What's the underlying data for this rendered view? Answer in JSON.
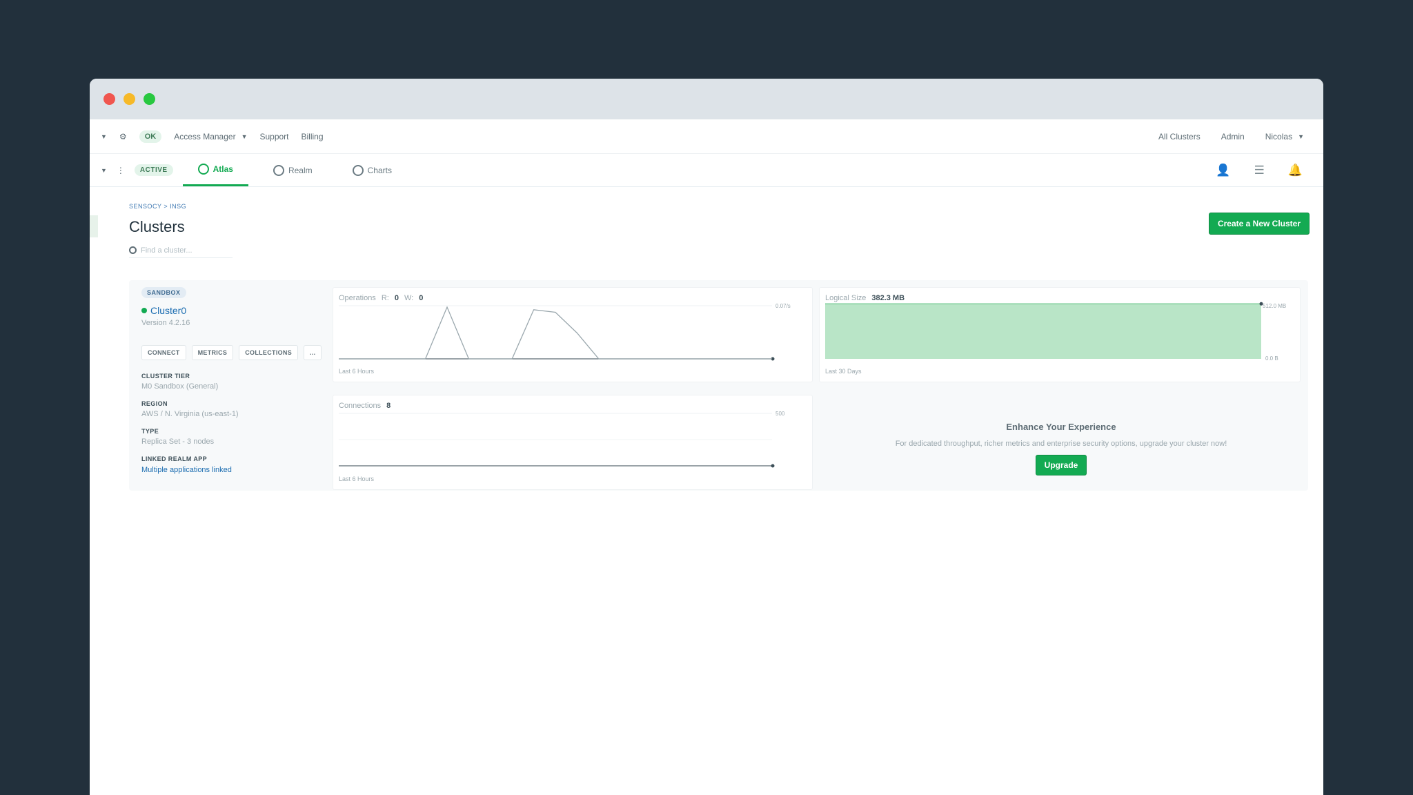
{
  "topnav": {
    "org": "OK",
    "access_manager": "Access Manager",
    "support": "Support",
    "billing": "Billing",
    "all_clusters": "All Clusters",
    "admin": "Admin",
    "user": "Nicolas"
  },
  "subnav": {
    "status": "ACTIVE",
    "tabs": [
      {
        "label": "Atlas",
        "active": true
      },
      {
        "label": "Realm",
        "active": false
      },
      {
        "label": "Charts",
        "active": false
      }
    ]
  },
  "page": {
    "breadcrumb": "SENSOCY > INSG",
    "title": "Clusters",
    "create_button": "Create a New Cluster",
    "search_placeholder": "Find a cluster..."
  },
  "cluster": {
    "badge": "SANDBOX",
    "name": "Cluster0",
    "version": "Version 4.2.16",
    "actions": [
      "CONNECT",
      "METRICS",
      "COLLECTIONS",
      "..."
    ],
    "tier_label": "CLUSTER TIER",
    "tier_value": "M0 Sandbox (General)",
    "region_label": "REGION",
    "region_value": "AWS / N. Virginia (us-east-1)",
    "type_label": "TYPE",
    "type_value": "Replica Set - 3 nodes",
    "realm_label": "LINKED REALM APP",
    "realm_value": "Multiple applications linked"
  },
  "panels": {
    "operations": {
      "title": "Operations",
      "r_label": "R:",
      "r": "0",
      "w_label": "W:",
      "w": "0",
      "ymax": "0.07/s",
      "foot": "Last 6 Hours"
    },
    "logical_size": {
      "title": "Logical Size",
      "value": "382.3 MB",
      "ymax": "512.0 MB",
      "ymin": "0.0 B",
      "foot": "Last 30 Days",
      "fill_color": "#b9e5c7"
    },
    "connections": {
      "title": "Connections",
      "value": "8",
      "ymax": "500",
      "foot": "Last 6 Hours"
    }
  },
  "chart_data": [
    {
      "type": "line",
      "title": "Operations",
      "x": [
        0,
        1,
        2,
        3,
        4,
        5,
        6,
        7,
        8,
        9,
        10,
        11,
        12,
        13,
        14,
        15,
        16,
        17,
        18,
        19,
        20
      ],
      "values": [
        0,
        0,
        0,
        0,
        0,
        1,
        0,
        0,
        0,
        0.95,
        0.9,
        0.5,
        0,
        0,
        0,
        0,
        0,
        0,
        0,
        0,
        0
      ],
      "xlabel": "Last 6 Hours"
    },
    {
      "type": "area",
      "title": "Logical Size",
      "values": [
        382.3,
        382.3
      ],
      "ylim": [
        0,
        512
      ],
      "xlabel": "Last 30 Days"
    },
    {
      "type": "line",
      "title": "Connections",
      "values": [
        0,
        0
      ],
      "xlabel": "Last 6 Hours"
    }
  ],
  "upsell": {
    "title": "Enhance Your Experience",
    "text": "For dedicated throughput, richer metrics and enterprise security options, upgrade your cluster now!",
    "button": "Upgrade"
  }
}
